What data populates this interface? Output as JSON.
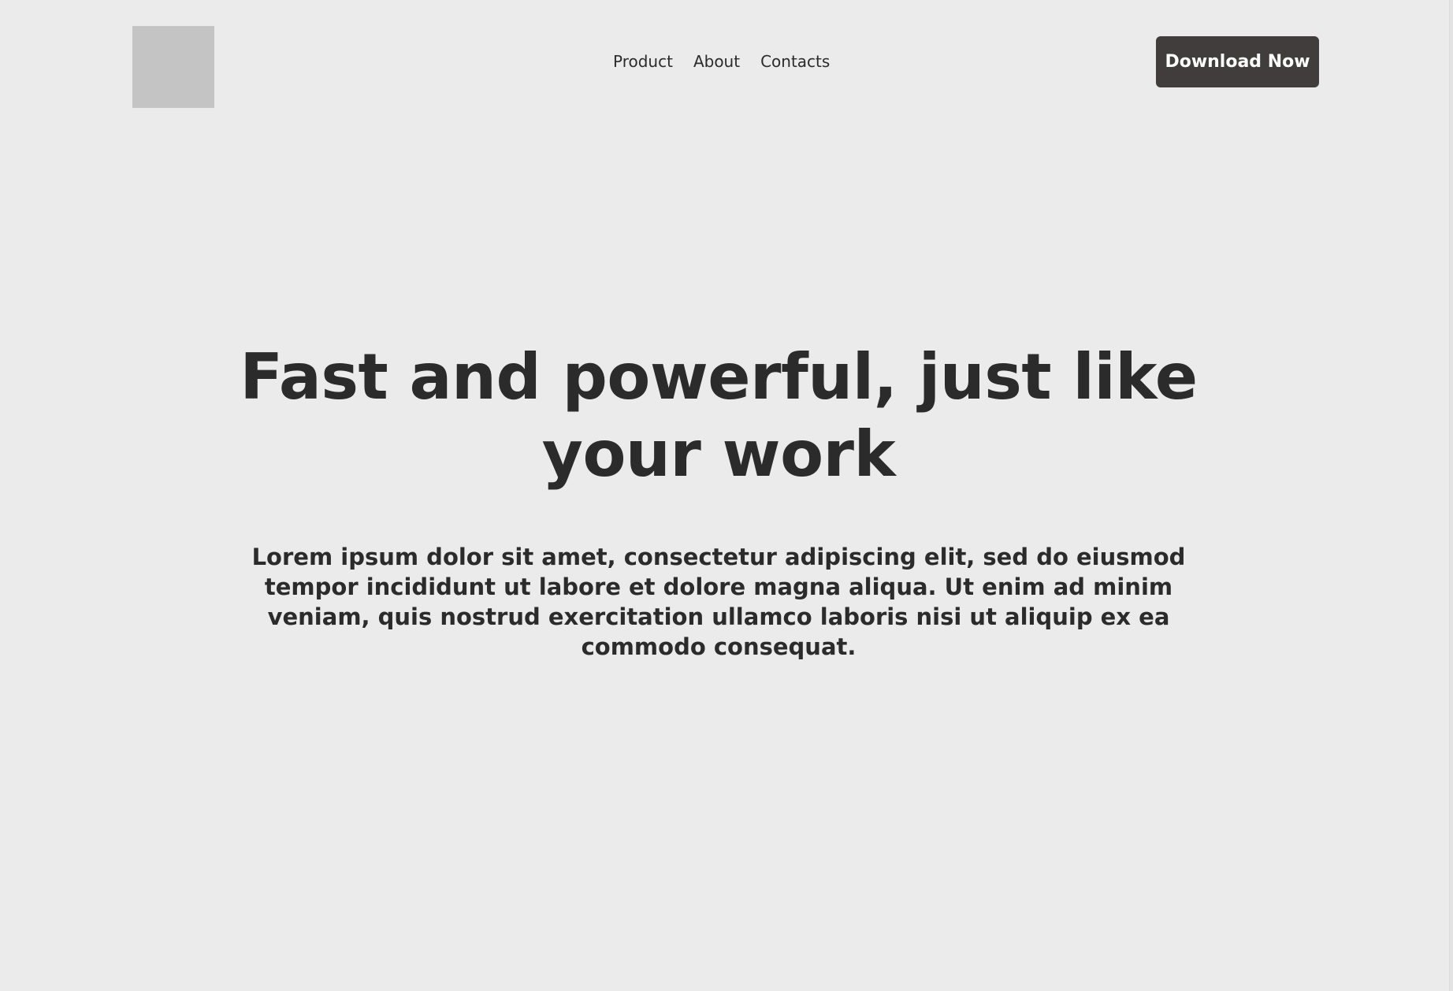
{
  "header": {
    "logo": "logo-placeholder",
    "nav": [
      {
        "label": "Product"
      },
      {
        "label": "About"
      },
      {
        "label": "Contacts"
      }
    ],
    "cta_label": "Download Now"
  },
  "hero": {
    "title": "Fast and powerful, just like your work",
    "description": "Lorem ipsum dolor sit amet, consectetur adipiscing elit, sed do eiusmod tempor incididunt ut labore et dolore magna aliqua. Ut enim ad minim veniam, quis nostrud exercitation ullamco laboris nisi ut aliquip ex ea commodo consequat."
  },
  "colors": {
    "background": "#ebebeb",
    "text": "#2b2b2b",
    "logo_placeholder": "#c4c4c4",
    "button": "#403d3c",
    "button_text": "#ffffff"
  }
}
